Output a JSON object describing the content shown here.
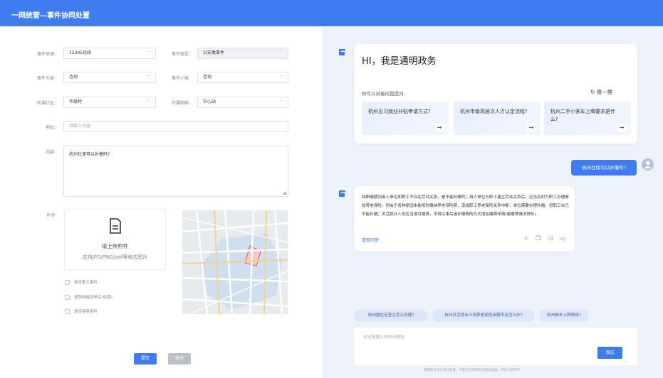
{
  "header": {
    "title": "一网统管—事件协同处置"
  },
  "form": {
    "source_label": "事件来源:",
    "source_value": "12345热线",
    "type_label": "事件类型:",
    "type_value": "公安类事件",
    "major_label": "事件大类:",
    "major_value": "咨询",
    "minor_label": "事件小类:",
    "minor_value": "咨询",
    "community_label": "所属社区:",
    "community_value": "华联村",
    "grid_label": "所属网格:",
    "grid_value": "中心站",
    "address_label": "地址:",
    "address_placeholder": "请输入内容",
    "content_label": "内容:",
    "content_value": "杭州社保可以补缴吗?",
    "attach_label": "附件",
    "upload_title": "请上传附件",
    "upload_hint": "支持JPG/PNG/pdf等格式图片",
    "checkboxes": [
      "是否重大事件",
      "按照网格员核实(处置)",
      "是否疑惑事件"
    ],
    "submit": "提交",
    "cancel": "取消"
  },
  "assistant": {
    "greeting": "HI，我是通明政务",
    "suggest_label": "你可以试着向我提问:",
    "refresh": "换一换",
    "questions": [
      "杭州见习就业补贴申请方式?",
      "杭州市级高层次人才认定流程?",
      "杭州二手小客车上牌要求是什么?"
    ],
    "user_msg": "杭州社保可以补缴吗?",
    "answer": "如断缴期间用人单位和职工不存在劳动关系，是不能补缴的；用人单位与职工建立劳动关系后，应当及时为职工办理参加养老保险。但由于各种原因未能按时缴纳养老保险费，造成职工养老保险关系中断，单位需要办理补缴。但职工自己不能补缴；灵活就业人员应当按月缴费，不得以事后追补缴费的方式增加缴费年限(缓缴等情况除外)",
    "regen": "重新回答",
    "chips": [
      "杭州居住证签注怎么办理?",
      "杭州灵活就业人员养老保险余额不足怎么办?",
      "杭州新车上牌费用?"
    ],
    "input_placeholder": "在这里输入你的问题吧",
    "send": "发送",
    "footer": "通明政务是生成式智能，不能完全保障信息真实准确，仅供大家参考"
  },
  "colors": {
    "primary": "#3f7cf0",
    "chip_bg": "#dde6fa"
  },
  "icons": [
    "logo-icon",
    "chevron-down-icon",
    "document-icon",
    "refresh-icon",
    "arrow-right-icon",
    "star-icon",
    "copy-icon",
    "thumbs-up-icon",
    "thumbs-down-icon",
    "avatar-icon"
  ]
}
